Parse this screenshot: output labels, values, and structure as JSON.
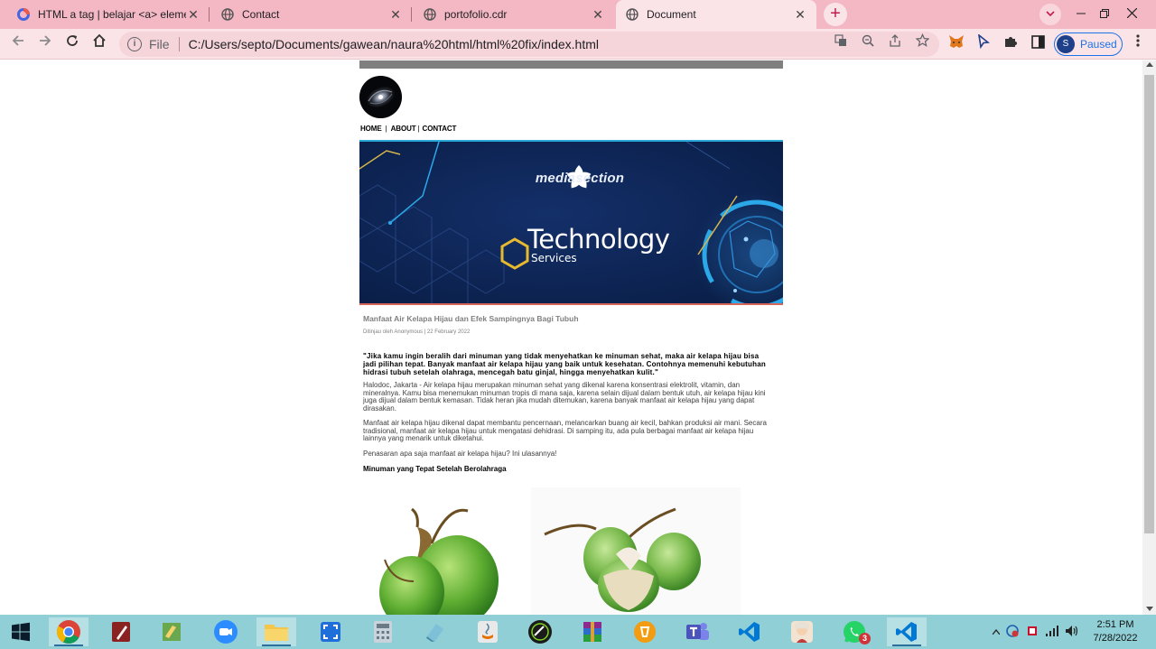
{
  "browser": {
    "tabs": [
      {
        "title": "HTML a tag | belajar <a> elemen",
        "icon": "chrome-history-icon",
        "active": false
      },
      {
        "title": "Contact",
        "icon": "globe-icon",
        "active": false
      },
      {
        "title": "portofolio.cdr",
        "icon": "globe-icon",
        "active": false
      },
      {
        "title": "Document",
        "icon": "globe-icon",
        "active": true
      }
    ],
    "close_glyph": "✕",
    "new_tab_glyph": "+",
    "address": {
      "scheme_label": "File",
      "url": "C:/Users/septo/Documents/gawean/naura%20html/html%20fix/index.html"
    },
    "profile": {
      "initial": "S",
      "status": "Paused"
    }
  },
  "page": {
    "nav": [
      {
        "label": "HOME"
      },
      {
        "label": "ABOUT"
      },
      {
        "label": "CONTACT"
      }
    ],
    "nav_separator": "|",
    "banner": {
      "brand": "mediasection",
      "headline": "Technology",
      "subline": "Services"
    },
    "article": {
      "title": "Manfaat Air Kelapa Hijau dan Efek Sampingnya Bagi Tubuh",
      "meta": "Ditinjau oleh Anonymous | 22 February 2022",
      "quote": "\"Jika kamu ingin beralih dari minuman yang tidak menyehatkan ke minuman sehat, maka air kelapa hijau bisa jadi pilihan tepat. Banyak manfaat air kelapa hijau yang baik untuk kesehatan. Contohnya memenuhi kebutuhan hidrasi tubuh setelah olahraga, mencegah batu ginjal, hingga menyehatkan kulit.\"",
      "paragraphs": [
        "Halodoc, Jakarta - Air kelapa hijau merupakan minuman sehat yang dikenal karena konsentrasi elektrolit, vitamin, dan mineralnya. Kamu bisa menemukan minuman tropis di mana saja, karena selain dijual dalam bentuk utuh, air kelapa hijau kini juga dijual dalam bentuk kemasan. Tidak heran jika mudah ditemukan, karena banyak manfaat air kelapa hijau yang dapat dirasakan.",
        "Manfaat air kelapa hijau dikenal dapat membantu pencernaan, melancarkan buang air kecil, bahkan produksi air mani. Secara tradisional, manfaat air kelapa hijau untuk mengatasi dehidrasi. Di samping itu, ada pula berbagai manfaat air kelapa hijau lainnya yang menarik untuk diketahui.",
        "Penasaran apa saja manfaat air kelapa hijau? Ini ulasannya!"
      ],
      "subheading": "Minuman yang Tepat Setelah Berolahraga"
    }
  },
  "taskbar": {
    "apps": [
      {
        "name": "start-button",
        "icon": "windows-icon"
      },
      {
        "name": "chrome",
        "icon": "chrome-icon"
      },
      {
        "name": "pen-app",
        "icon": "pen-icon"
      },
      {
        "name": "notes-app",
        "icon": "notes-icon"
      },
      {
        "name": "zoom",
        "icon": "zoom-icon"
      },
      {
        "name": "file-explorer",
        "icon": "folder-icon"
      },
      {
        "name": "screen-capture",
        "icon": "capture-icon"
      },
      {
        "name": "calculator",
        "icon": "calculator-icon"
      },
      {
        "name": "eraser-app",
        "icon": "eraser-icon"
      },
      {
        "name": "java",
        "icon": "java-icon"
      },
      {
        "name": "inkscape",
        "icon": "inkscape-icon"
      },
      {
        "name": "winrar",
        "icon": "winrar-icon"
      },
      {
        "name": "app-orange",
        "icon": "orange-app-icon"
      },
      {
        "name": "teams",
        "icon": "teams-icon"
      },
      {
        "name": "vscode",
        "icon": "vscode-icon"
      },
      {
        "name": "game-app",
        "icon": "game-icon"
      },
      {
        "name": "whatsapp",
        "icon": "whatsapp-icon",
        "badge": "3"
      },
      {
        "name": "vscode-2",
        "icon": "vscode-icon"
      }
    ],
    "clock": {
      "time": "2:51 PM",
      "date": "7/28/2022"
    }
  },
  "colors": {
    "tabstrip": "#f4b7c4",
    "toolbar": "#fbe4e8",
    "accent": "#1a73e8",
    "taskbar": "#8fcfd5",
    "banner": "#0d2a5c"
  }
}
